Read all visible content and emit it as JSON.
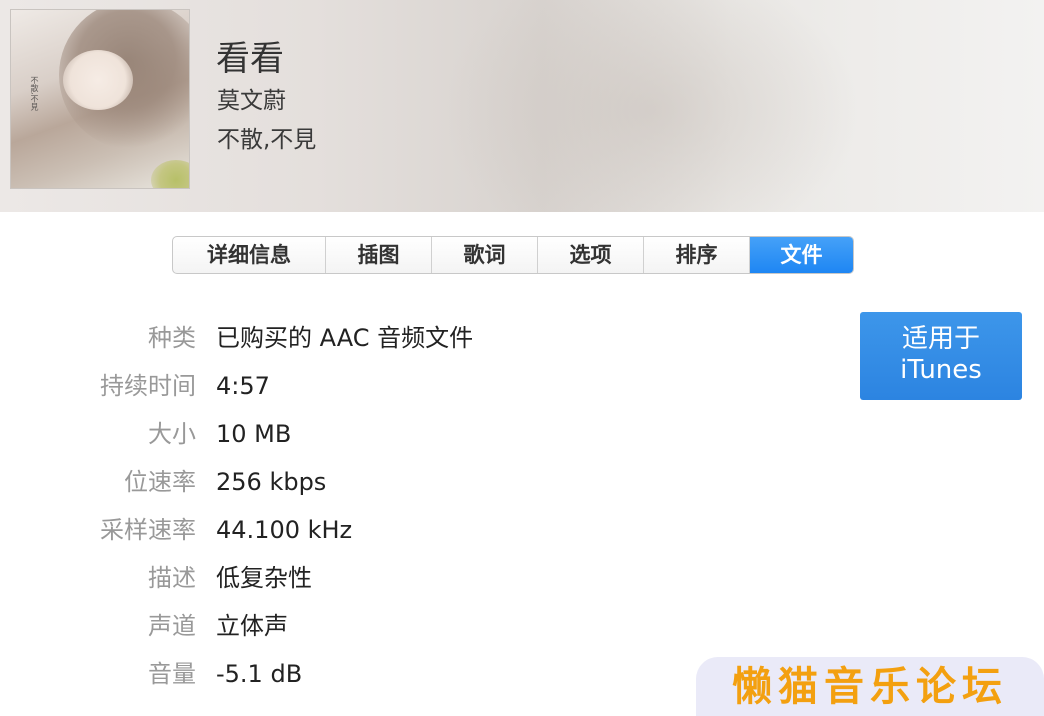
{
  "song": {
    "title": "看看",
    "artist": "莫文蔚",
    "album": "不散,不見"
  },
  "artwork": {
    "text": "不散,不見"
  },
  "tabs": [
    {
      "label": "详细信息",
      "active": false
    },
    {
      "label": "插图",
      "active": false
    },
    {
      "label": "歌词",
      "active": false
    },
    {
      "label": "选项",
      "active": false
    },
    {
      "label": "排序",
      "active": false
    },
    {
      "label": "文件",
      "active": true
    }
  ],
  "file_info": [
    {
      "label": "种类",
      "value": "已购买的 AAC 音频文件"
    },
    {
      "label": "持续时间",
      "value": "4:57"
    },
    {
      "label": "大小",
      "value": "10 MB"
    },
    {
      "label": "位速率",
      "value": "256 kbps"
    },
    {
      "label": "采样速率",
      "value": "44.100 kHz"
    },
    {
      "label": "描述",
      "value": "低复杂性"
    },
    {
      "label": "声道",
      "value": "立体声"
    },
    {
      "label": "音量",
      "value": "-5.1 dB"
    }
  ],
  "itunes_button": {
    "line1": "适用于",
    "line2": "iTunes"
  },
  "watermark": {
    "text": "懒猫音乐论坛"
  },
  "colors": {
    "accent": "#2c84e1",
    "watermark_text": "#f3a010",
    "label_gray": "#999999"
  }
}
